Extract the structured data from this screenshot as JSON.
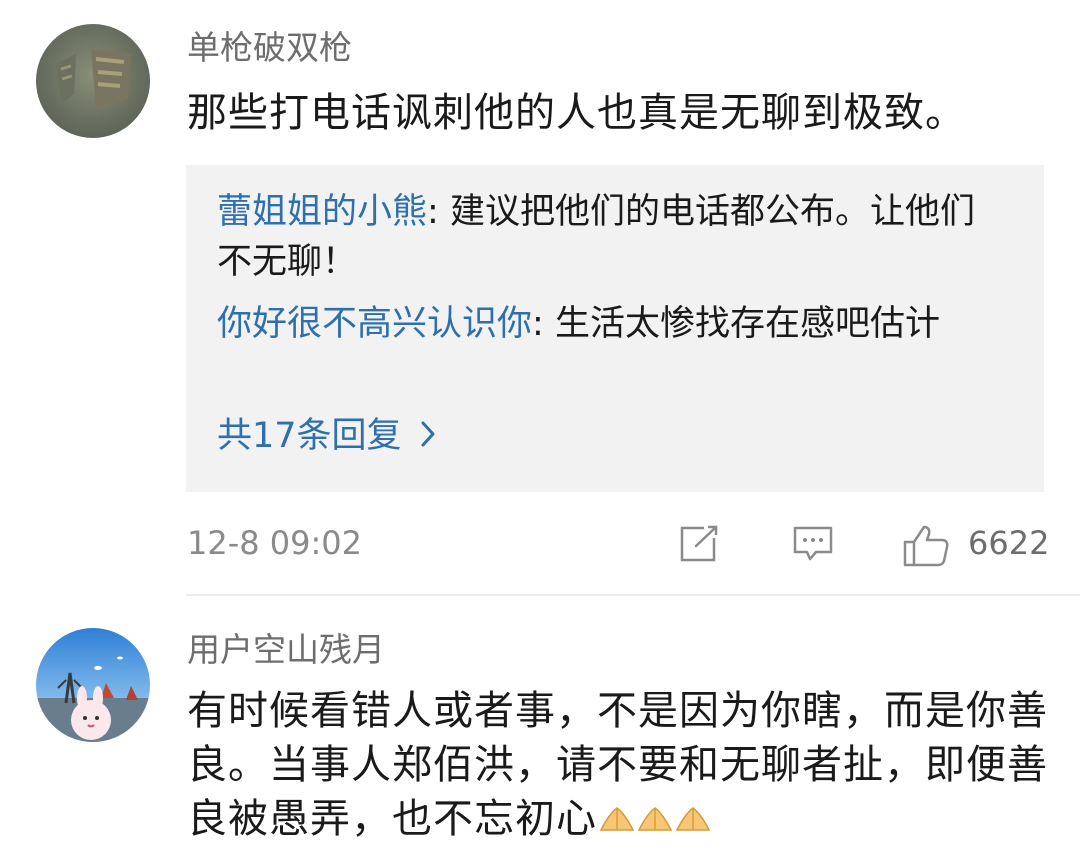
{
  "comments": [
    {
      "username": "单枪破双枪",
      "text": "那些打电话讽刺他的人也真是无聊到极致。",
      "replies": [
        {
          "name": "蕾姐姐的小熊",
          "sep": ": ",
          "text": "建议把他们的电话都公布。让他们不无聊！"
        },
        {
          "name": "你好很不高兴认识你",
          "sep": ": ",
          "text": "生活太惨找存在感吧估计"
        }
      ],
      "more_replies": "共17条回复",
      "time": "12-8 09:02",
      "like_count": "6622"
    },
    {
      "username": "用户空山残月",
      "text": "有时候看错人或者事，不是因为你瞎，而是你善良。当事人郑佰洪，请不要和无聊者扯，即便善良被愚弄，也不忘初心",
      "emoji": [
        "praying-hands",
        "praying-hands",
        "praying-hands"
      ]
    }
  ],
  "icons": {
    "repost": "edit-share-icon",
    "comment": "comment-bubble-icon",
    "like": "thumbs-up-icon",
    "more": "chevron-right-icon"
  },
  "colors": {
    "link": "#2e6fad",
    "meta": "#8a8a8a",
    "reply_bg": "#f2f2f2"
  }
}
